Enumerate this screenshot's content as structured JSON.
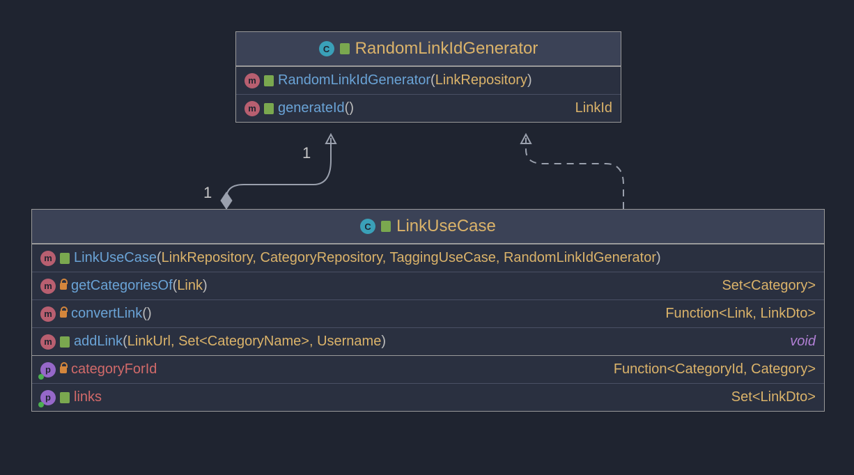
{
  "classes": {
    "generator": {
      "title": "RandomLinkIdGenerator",
      "members": [
        {
          "kind": "m",
          "vis": "public",
          "name": "RandomLinkIdGenerator",
          "paramsPrefix": "(",
          "paramsTypes": "LinkRepository",
          "paramsSuffix": ")",
          "return": ""
        },
        {
          "kind": "m",
          "vis": "public",
          "name": "generateId",
          "paramsPrefix": "(",
          "paramsTypes": "",
          "paramsSuffix": ")",
          "return": "LinkId"
        }
      ]
    },
    "usecase": {
      "title": "LinkUseCase",
      "members": [
        {
          "kind": "m",
          "vis": "public",
          "name": "LinkUseCase",
          "paramsPrefix": "(",
          "paramsTypes": "LinkRepository, CategoryRepository, TaggingUseCase, RandomLinkIdGenerator",
          "paramsSuffix": ")",
          "return": ""
        },
        {
          "kind": "m",
          "vis": "private",
          "name": "getCategoriesOf",
          "paramsPrefix": "(",
          "paramsTypes": "Link",
          "paramsSuffix": ")",
          "return": "Set<Category>"
        },
        {
          "kind": "m",
          "vis": "private",
          "name": "convertLink",
          "paramsPrefix": "(",
          "paramsTypes": "",
          "paramsSuffix": ")",
          "return": "Function<Link, LinkDto>"
        },
        {
          "kind": "m",
          "vis": "public",
          "name": "addLink",
          "paramsPrefix": "(",
          "paramsTypes": "LinkUrl, Set<CategoryName>, Username",
          "paramsSuffix": ")",
          "return": "void"
        }
      ],
      "properties": [
        {
          "kind": "p",
          "vis": "private",
          "name": "categoryForId",
          "return": "Function<CategoryId, Category>"
        },
        {
          "kind": "p",
          "vis": "public",
          "name": "links",
          "return": "Set<LinkDto>"
        }
      ]
    }
  },
  "relations": {
    "mult1": "1",
    "mult2": "1"
  }
}
